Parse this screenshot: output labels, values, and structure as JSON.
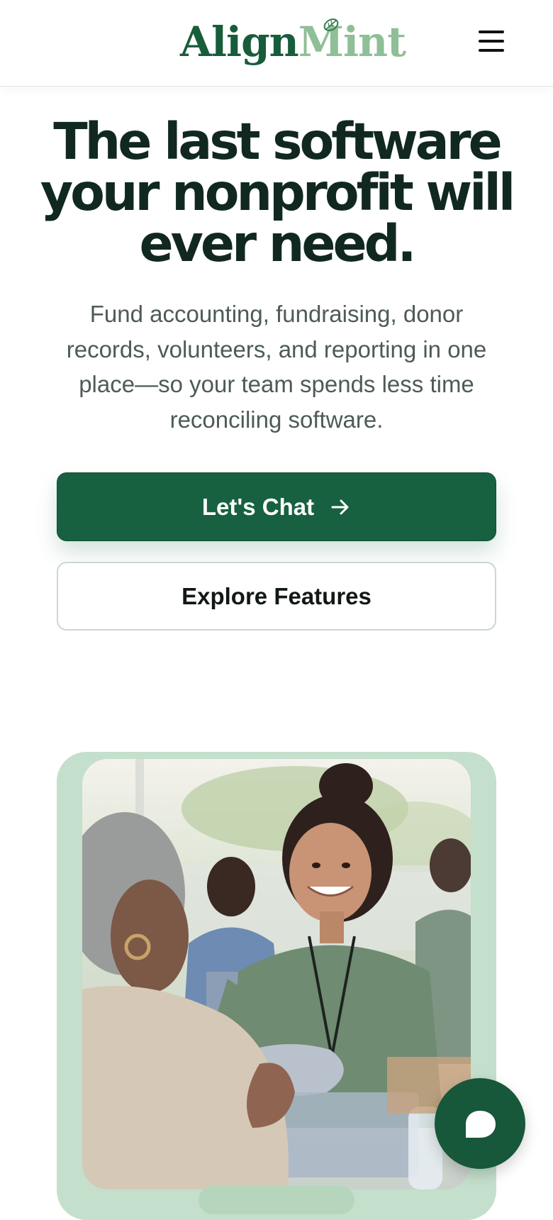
{
  "header": {
    "logo_part1": "Align",
    "logo_part2": "Mint",
    "menu_icon": "hamburger-menu-icon"
  },
  "hero": {
    "title": "The last software your nonprofit will ever need.",
    "subtitle": "Fund accounting, fundraising, donor records, volunteers, and reporting in one place—so your team spends less time reconciling software.",
    "primary_button": {
      "label": "Let's Chat",
      "icon": "arrow-right-icon"
    },
    "secondary_button": {
      "label": "Explore Features"
    }
  },
  "chat_widget": {
    "icon": "chat-bubble-icon"
  },
  "colors": {
    "brand_green": "#176140",
    "mint": "#8fbf96",
    "frame_green": "#c4dfcb",
    "heading": "#112820",
    "body_text": "#4e5b55"
  }
}
